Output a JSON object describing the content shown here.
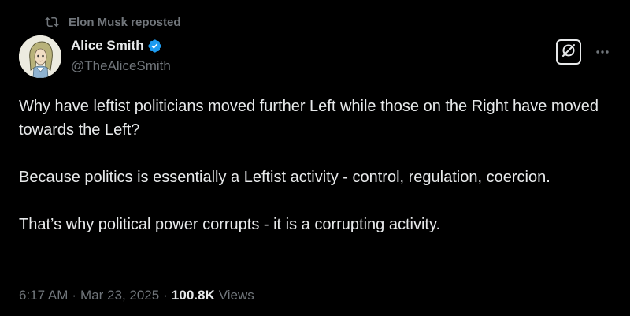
{
  "repost": {
    "label": "Elon Musk reposted",
    "icon": "repost-icon"
  },
  "author": {
    "display_name": "Alice Smith",
    "handle": "@TheAliceSmith",
    "verified_icon": "verified-badge-icon",
    "verified_color": "#1d9bf0"
  },
  "tweet": {
    "paragraphs": [
      "Why have leftist politicians moved further Left while those on the Right have moved towards the Left?",
      "Because politics is essentially a Leftist activity - control, regulation, coercion.",
      "That’s why political power corrupts - it is a corrupting activity."
    ]
  },
  "meta": {
    "time": "6:17 AM",
    "separator": "·",
    "date": "Mar 23, 2025",
    "views_count": "100.8K",
    "views_label": "Views"
  },
  "actions": {
    "grok_icon": "grok-icon",
    "more_icon": "more-icon"
  },
  "colors": {
    "background": "#000000",
    "text_primary": "#e7e9ea",
    "text_secondary": "#71767b"
  }
}
